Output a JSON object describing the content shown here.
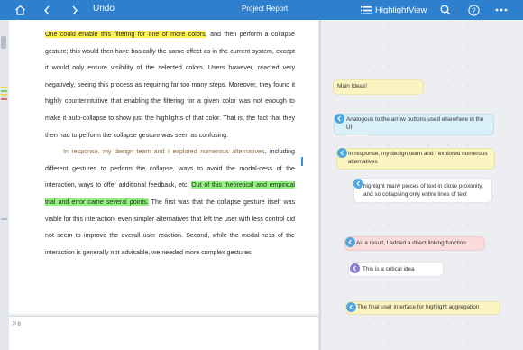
{
  "toolbar": {
    "undo_label": "Undo",
    "title": "Project Report",
    "view_label": "HighlightView",
    "icons": [
      "home-icon",
      "back-arrow-icon",
      "forward-arrow-icon",
      "list-view-icon",
      "search-icon",
      "help-icon",
      "more-icon"
    ]
  },
  "document": {
    "para1_hl": "One could enable this filtering for one of more colors",
    "para1_rest": ", and then perform a collapse gesture; this would then have basically the same effect as in the current system, except it would only ensure visibility of the selected colors. Users however, reacted very negatively, seeing this process as requiring far too many steps. Moreover, they found it highly counterintuitive that enabling the filtering for a given color was not enough to make it auto-collapse to show just the highlights of that color. That is, the fact that they then had to perform the collapse gesture was seen as confusing.",
    "para2_intro": "In response, my design team and I explored numerous alternatives",
    "para2_mid": ", including different gestures to perform the collapse, ways to avoid the modal-ness of the interaction, ways to offer additional feedback, etc. ",
    "para2_hl": "Out of this theoretical and empirical trial and error came several points.",
    "para2_rest": " The first was that the collapse gesture itself was viable for this interaction; even simpler alternatives that left the user with less control did not seem to improve the overall user reaction. Second, while the modal-ness of the interaction is generally not advisable, we needed more complex gestures",
    "page_number": "P 8"
  },
  "notes": {
    "n1": "Main Ideas!",
    "n2": "Analogous to the arrow buttons used elsewhere in the UI",
    "n3": "In response, my design team and I explored numerous alternatives",
    "n4": "highlight many pieces of text in close proximity, and so  collapsing only entire lines of text",
    "n5": "As a result, I added a direct linking function",
    "n6": "This is a critical idea",
    "n7": "The final user interface for highlight aggregation"
  },
  "colors": {
    "toolbar": "#2e7fce",
    "yellow_note": "#fbf3c0",
    "blue_note": "#d9f0f8",
    "pink_note": "#fadada",
    "white_note": "#ffffff",
    "link_icon": "#4ea6e0",
    "critical_icon": "#8a7fd8"
  }
}
